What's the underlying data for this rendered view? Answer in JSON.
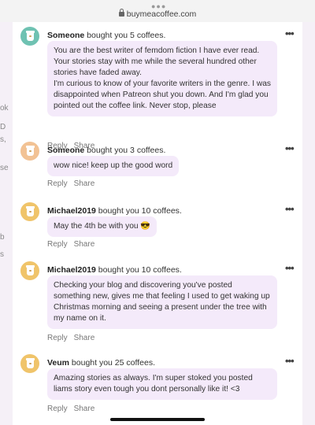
{
  "browser": {
    "url": "buymeacoffee.com"
  },
  "background_fragments": [
    "ok",
    "D",
    "s,",
    "se",
    "b",
    "s"
  ],
  "supporters": [
    {
      "name": "Someone",
      "action": " bought you 5 coffees.",
      "message": "You are the best writer of femdom fiction I have ever read. Your stories stay with me while the several hundred other stories have faded away.\nI'm curious to know of your favorite writers in the genre. I was disappointed when Patreon shut you down. And I'm glad you pointed out the coffee link. Never stop, please",
      "reply_label": "Reply",
      "share_label": "Share",
      "avatar_color": "#6fc2b2"
    },
    {
      "name": "Someone",
      "action": " bought you 3 coffees.",
      "message": "wow nice! keep up the good word",
      "reply_label": "Reply",
      "share_label": "Share",
      "avatar_color": "#f2c294"
    },
    {
      "name": "Michael2019",
      "action": " bought you 10 coffees.",
      "message": "May the 4th be with you 😎",
      "reply_label": "Reply",
      "share_label": "Share",
      "avatar_color": "#f0c46a"
    },
    {
      "name": "Michael2019",
      "action": " bought you 10 coffees.",
      "message": "Checking your blog and discovering you've posted something new, gives me that feeling I used to get waking up Christmas morning and seeing a present under the tree with my name on it.",
      "reply_label": "Reply",
      "share_label": "Share",
      "avatar_color": "#f0c46a"
    },
    {
      "name": "Veum",
      "action": " bought you 25 coffees.",
      "message": "Amazing stories as always. I'm super stoked you posted liams story even tough you dont personally like it! <3",
      "reply_label": "Reply",
      "share_label": "Share",
      "avatar_color": "#f0c46a"
    }
  ]
}
